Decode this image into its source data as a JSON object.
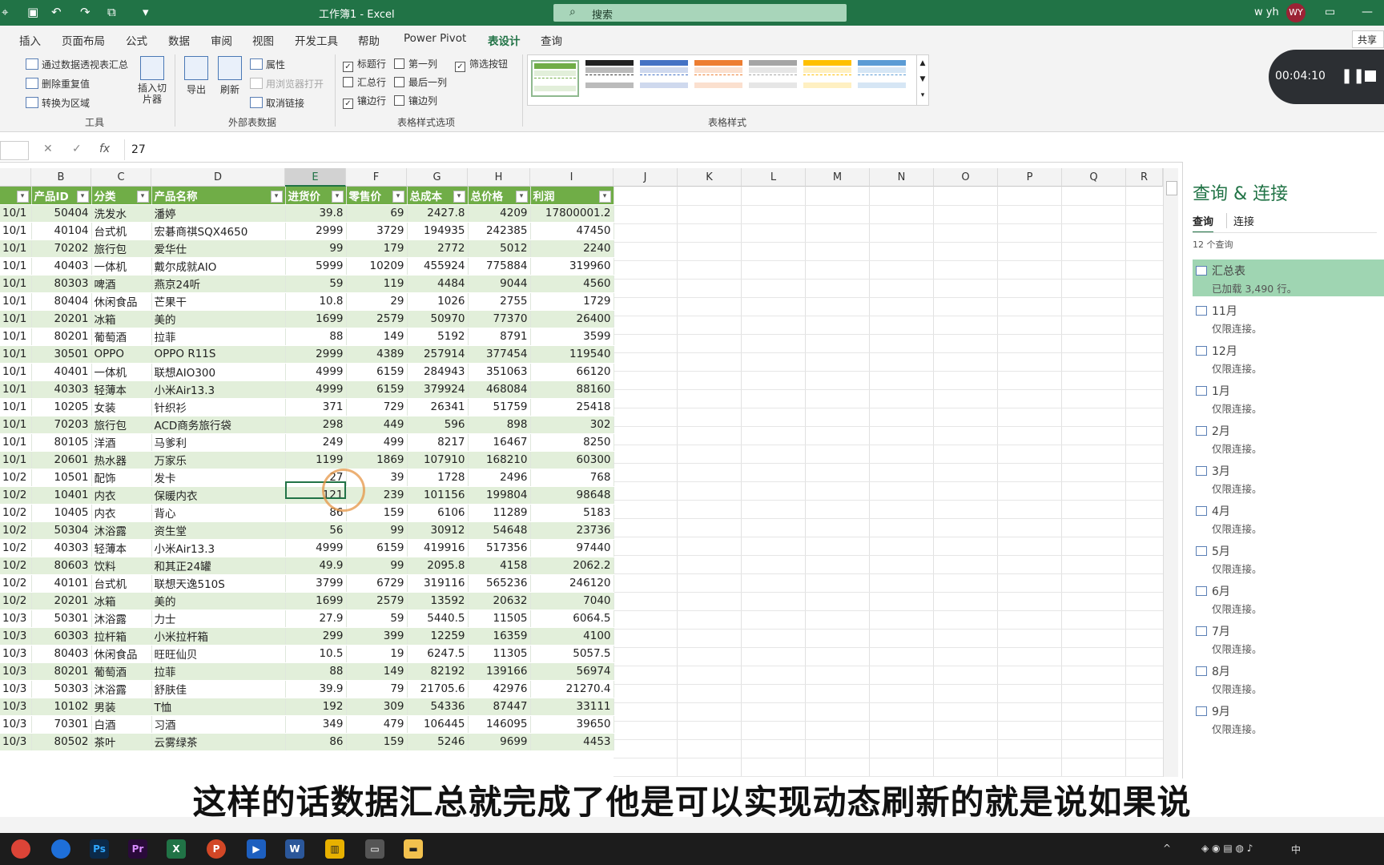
{
  "titlebar": {
    "title": "工作簿1  -  Excel",
    "search_placeholder": "搜索",
    "user_name": "w yh",
    "avatar_initials": "WY",
    "accent_color": "#217346"
  },
  "ribbon_tabs": [
    "插入",
    "页面布局",
    "公式",
    "数据",
    "审阅",
    "视图",
    "开发工具",
    "帮助",
    "Power Pivot",
    "表设计",
    "查询"
  ],
  "active_tab": "表设计",
  "share_label": "共享",
  "ribbon": {
    "tools": {
      "summarize_pivot": "通过数据透视表汇总",
      "remove_duplicates": "删除重复值",
      "convert_range": "转换为区域",
      "insert_slicer": "插入切片器",
      "group_label": "工具"
    },
    "external": {
      "export": "导出",
      "refresh": "刷新",
      "properties": "属性",
      "open_browser": "用浏览器打开",
      "unlink": "取消链接",
      "group_label": "外部表数据"
    },
    "style_options": {
      "header_row": "标题行",
      "total_row": "汇总行",
      "banded_rows": "镶边行",
      "first_column": "第一列",
      "last_column": "最后一列",
      "banded_columns": "镶边列",
      "filter_button": "筛选按钮",
      "group_label": "表格样式选项"
    },
    "styles_group_label": "表格样式"
  },
  "recorder": {
    "time": "00:04:10"
  },
  "formula_bar": {
    "value": "27"
  },
  "columns": [
    "B",
    "C",
    "D",
    "E",
    "F",
    "G",
    "H",
    "I",
    "J",
    "K",
    "L",
    "M",
    "N",
    "O",
    "P",
    "Q",
    "R"
  ],
  "selected_column": "E",
  "table": {
    "headers": [
      "",
      "产品ID",
      "分类",
      "产品名称",
      "进货价",
      "零售价",
      "总成本",
      "总价格",
      "利润"
    ],
    "rows": [
      [
        "10/1",
        "50404",
        "洗发水",
        "潘婷",
        "39.8",
        "69",
        "2427.8",
        "4209",
        "17800001.2"
      ],
      [
        "10/1",
        "40104",
        "台式机",
        "宏碁商祺SQX4650",
        "2999",
        "3729",
        "194935",
        "242385",
        "47450"
      ],
      [
        "10/1",
        "70202",
        "旅行包",
        "爱华仕",
        "99",
        "179",
        "2772",
        "5012",
        "2240"
      ],
      [
        "10/1",
        "40403",
        "一体机",
        "戴尔成就AIO",
        "5999",
        "10209",
        "455924",
        "775884",
        "319960"
      ],
      [
        "10/1",
        "80303",
        "啤酒",
        "燕京24听",
        "59",
        "119",
        "4484",
        "9044",
        "4560"
      ],
      [
        "10/1",
        "80404",
        "休闲食品",
        "芒果干",
        "10.8",
        "29",
        "1026",
        "2755",
        "1729"
      ],
      [
        "10/1",
        "20201",
        "冰箱",
        "美的",
        "1699",
        "2579",
        "50970",
        "77370",
        "26400"
      ],
      [
        "10/1",
        "80201",
        "葡萄酒",
        "拉菲",
        "88",
        "149",
        "5192",
        "8791",
        "3599"
      ],
      [
        "10/1",
        "30501",
        "OPPO",
        "OPPO R11S",
        "2999",
        "4389",
        "257914",
        "377454",
        "119540"
      ],
      [
        "10/1",
        "40401",
        "一体机",
        "联想AIO300",
        "4999",
        "6159",
        "284943",
        "351063",
        "66120"
      ],
      [
        "10/1",
        "40303",
        "轻薄本",
        "小米Air13.3",
        "4999",
        "6159",
        "379924",
        "468084",
        "88160"
      ],
      [
        "10/1",
        "10205",
        "女装",
        "针织衫",
        "371",
        "729",
        "26341",
        "51759",
        "25418"
      ],
      [
        "10/1",
        "70203",
        "旅行包",
        "ACD商务旅行袋",
        "298",
        "449",
        "596",
        "898",
        "302"
      ],
      [
        "10/1",
        "80105",
        "洋酒",
        "马爹利",
        "249",
        "499",
        "8217",
        "16467",
        "8250"
      ],
      [
        "10/1",
        "20601",
        "热水器",
        "万家乐",
        "1199",
        "1869",
        "107910",
        "168210",
        "60300"
      ],
      [
        "10/2",
        "10501",
        "配饰",
        "发卡",
        "27",
        "39",
        "1728",
        "2496",
        "768"
      ],
      [
        "10/2",
        "10401",
        "内衣",
        "保暖内衣",
        "121",
        "239",
        "101156",
        "199804",
        "98648"
      ],
      [
        "10/2",
        "10405",
        "内衣",
        "背心",
        "86",
        "159",
        "6106",
        "11289",
        "5183"
      ],
      [
        "10/2",
        "50304",
        "沐浴露",
        "资生堂",
        "56",
        "99",
        "30912",
        "54648",
        "23736"
      ],
      [
        "10/2",
        "40303",
        "轻薄本",
        "小米Air13.3",
        "4999",
        "6159",
        "419916",
        "517356",
        "97440"
      ],
      [
        "10/2",
        "80603",
        "饮料",
        "和其正24罐",
        "49.9",
        "99",
        "2095.8",
        "4158",
        "2062.2"
      ],
      [
        "10/2",
        "40101",
        "台式机",
        "联想天逸510S",
        "3799",
        "6729",
        "319116",
        "565236",
        "246120"
      ],
      [
        "10/2",
        "20201",
        "冰箱",
        "美的",
        "1699",
        "2579",
        "13592",
        "20632",
        "7040"
      ],
      [
        "10/3",
        "50301",
        "沐浴露",
        "力士",
        "27.9",
        "59",
        "5440.5",
        "11505",
        "6064.5"
      ],
      [
        "10/3",
        "60303",
        "拉杆箱",
        "小米拉杆箱",
        "299",
        "399",
        "12259",
        "16359",
        "4100"
      ],
      [
        "10/3",
        "80403",
        "休闲食品",
        "旺旺仙贝",
        "10.5",
        "19",
        "6247.5",
        "11305",
        "5057.5"
      ],
      [
        "10/3",
        "80201",
        "葡萄酒",
        "拉菲",
        "88",
        "149",
        "82192",
        "139166",
        "56974"
      ],
      [
        "10/3",
        "50303",
        "沐浴露",
        "舒肤佳",
        "39.9",
        "79",
        "21705.6",
        "42976",
        "21270.4"
      ],
      [
        "10/3",
        "10102",
        "男装",
        "T恤",
        "192",
        "309",
        "54336",
        "87447",
        "33111"
      ],
      [
        "10/3",
        "70301",
        "白酒",
        "习酒",
        "349",
        "479",
        "106445",
        "146095",
        "39650"
      ],
      [
        "10/3",
        "80502",
        "茶叶",
        "云雾绿茶",
        "86",
        "159",
        "5246",
        "9699",
        "4453"
      ]
    ]
  },
  "queries_pane": {
    "title": "查询 & 连接",
    "tabs": [
      "查询",
      "连接"
    ],
    "count": "12 个查询",
    "items": [
      {
        "name": "汇总表",
        "status": "已加载 3,490 行。"
      },
      {
        "name": "11月",
        "status": "仅限连接。"
      },
      {
        "name": "12月",
        "status": "仅限连接。"
      },
      {
        "name": "1月",
        "status": "仅限连接。"
      },
      {
        "name": "2月",
        "status": "仅限连接。"
      },
      {
        "name": "3月",
        "status": "仅限连接。"
      },
      {
        "name": "4月",
        "status": "仅限连接。"
      },
      {
        "name": "5月",
        "status": "仅限连接。"
      },
      {
        "name": "6月",
        "status": "仅限连接。"
      },
      {
        "name": "7月",
        "status": "仅限连接。"
      },
      {
        "name": "8月",
        "status": "仅限连接。"
      },
      {
        "name": "9月",
        "status": "仅限连接。"
      }
    ]
  },
  "subtitle": "这样的话数据汇总就完成了他是可以实现动态刷新的就是说如果说",
  "taskbar": {
    "apps": [
      "chrome-icon",
      "browser-icon",
      "photoshop-icon",
      "premiere-icon",
      "excel-icon",
      "powerpoint-icon",
      "recorder-icon",
      "word-icon",
      "chart-app-icon",
      "terminal-icon",
      "folder-icon"
    ],
    "ime": "中"
  }
}
